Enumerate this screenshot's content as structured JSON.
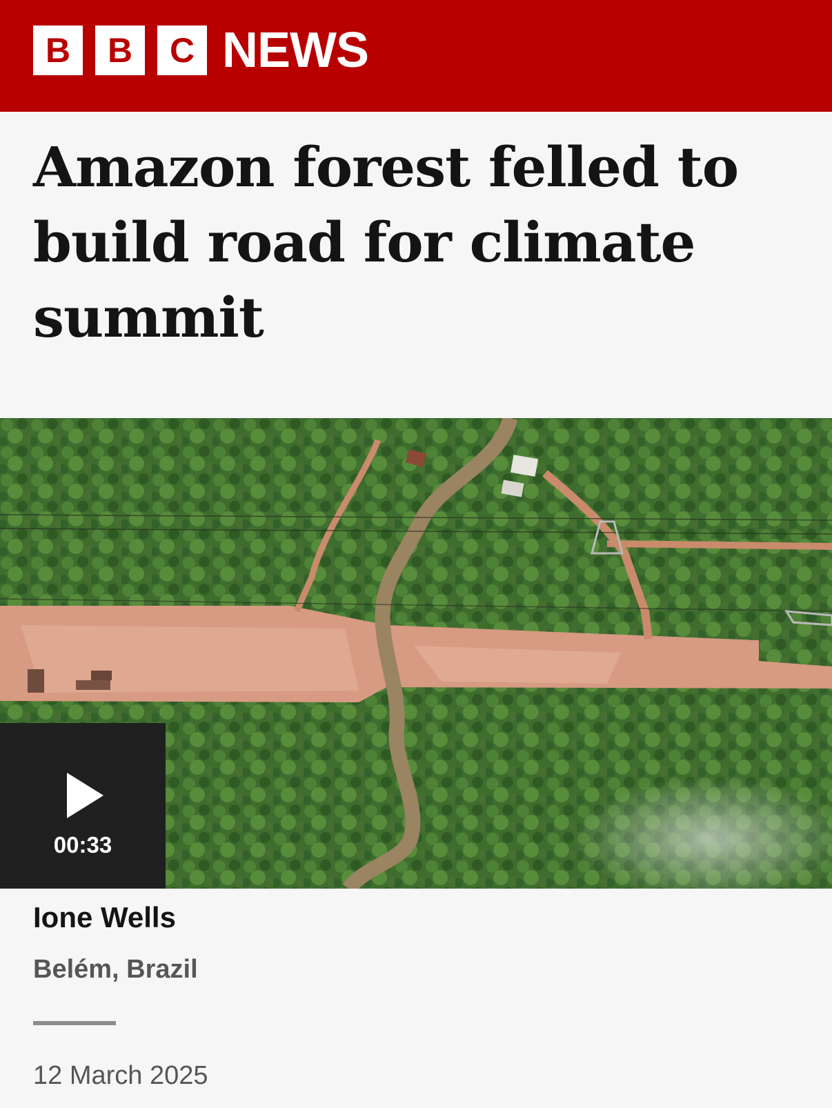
{
  "masthead": {
    "letters": [
      "B",
      "B",
      "C"
    ],
    "section": "NEWS",
    "brand_color": "#b80000"
  },
  "article": {
    "headline": "Amazon forest felled to build road for climate summit",
    "author": "Ione Wells",
    "location": "Belém, Brazil",
    "date": "12 March 2025"
  },
  "video": {
    "duration": "00:33",
    "play_icon": "play-icon"
  }
}
